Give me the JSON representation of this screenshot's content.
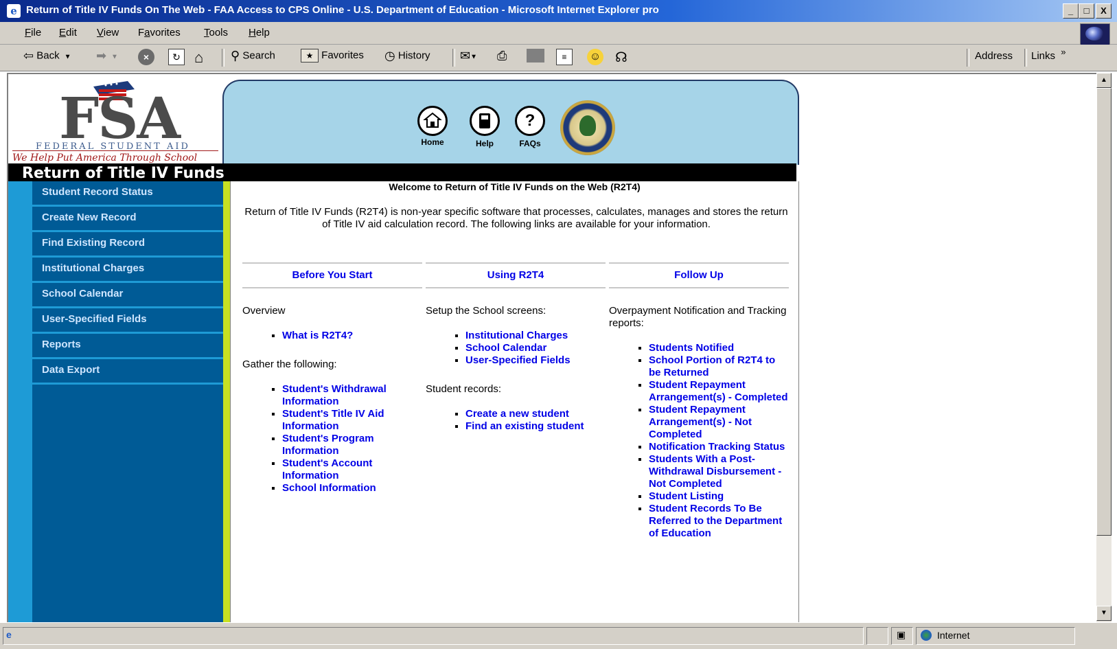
{
  "window": {
    "title": "Return of Title IV Funds On The Web - FAA Access to CPS Online - U.S. Department of Education - Microsoft Internet Explorer pro",
    "minimize": "_",
    "maximize": "□",
    "close": "X"
  },
  "menu": {
    "file": {
      "acc": "F",
      "rest": "ile"
    },
    "edit": {
      "acc": "E",
      "rest": "dit"
    },
    "view": {
      "acc": "V",
      "rest": "iew"
    },
    "favorites": {
      "pre": "F",
      "acc": "a",
      "rest": "vorites"
    },
    "tools": {
      "acc": "T",
      "rest": "ools"
    },
    "help": {
      "acc": "H",
      "rest": "elp"
    }
  },
  "toolbar": {
    "back": "Back",
    "search": "Search",
    "favorites": "Favorites",
    "history": "History",
    "address": "Address",
    "links": "Links",
    "chevron": "»"
  },
  "logo": {
    "letters": "FSA",
    "subtitle": "FEDERAL STUDENT AID",
    "tagline": "We Help Put America Through School"
  },
  "header": {
    "home": "Home",
    "help": "Help",
    "faqs": "FAQs",
    "help_glyph": "?"
  },
  "site_title": "Return of Title IV Funds",
  "nav": [
    "Student Record Status",
    "Create New Record",
    "Find Existing Record",
    "Institutional Charges",
    "School Calendar",
    "User-Specified Fields",
    "Reports",
    "Data Export"
  ],
  "content": {
    "welcome": "Welcome to Return of Title IV Funds on the Web (R2T4)",
    "intro": "Return of Title IV Funds (R2T4) is non-year specific software that processes, calculates, manages and stores the return of Title IV aid calculation record. The following links are available for your information.",
    "columns": [
      {
        "heading": "Before You Start",
        "sections": [
          {
            "text": "Overview",
            "links": [
              "What is R2T4?"
            ]
          },
          {
            "text": "Gather the following:",
            "links": [
              "Student's Withdrawal Information",
              "Student's Title IV Aid Information",
              "Student's Program Information",
              "Student's Account Information",
              "School Information"
            ]
          }
        ]
      },
      {
        "heading": "Using R2T4",
        "sections": [
          {
            "text": "Setup the School screens:",
            "links": [
              "Institutional Charges",
              "School Calendar",
              "User-Specified Fields"
            ]
          },
          {
            "text": "Student records:",
            "links": [
              "Create a new student",
              "Find an existing student"
            ]
          }
        ]
      },
      {
        "heading": "Follow Up",
        "sections": [
          {
            "text": "Overpayment Notification and Tracking reports:",
            "links": [
              "Students Notified",
              "School Portion of R2T4 to be Returned",
              "Student Repayment Arrangement(s) - Completed",
              "Student Repayment Arrangement(s) - Not Completed",
              "Notification Tracking Status",
              "Students With a Post-Withdrawal Disbursement - Not Completed",
              "Student Listing",
              "Student Records To Be Referred to the Department of Education"
            ]
          }
        ]
      }
    ]
  },
  "status": {
    "zone": "Internet"
  }
}
